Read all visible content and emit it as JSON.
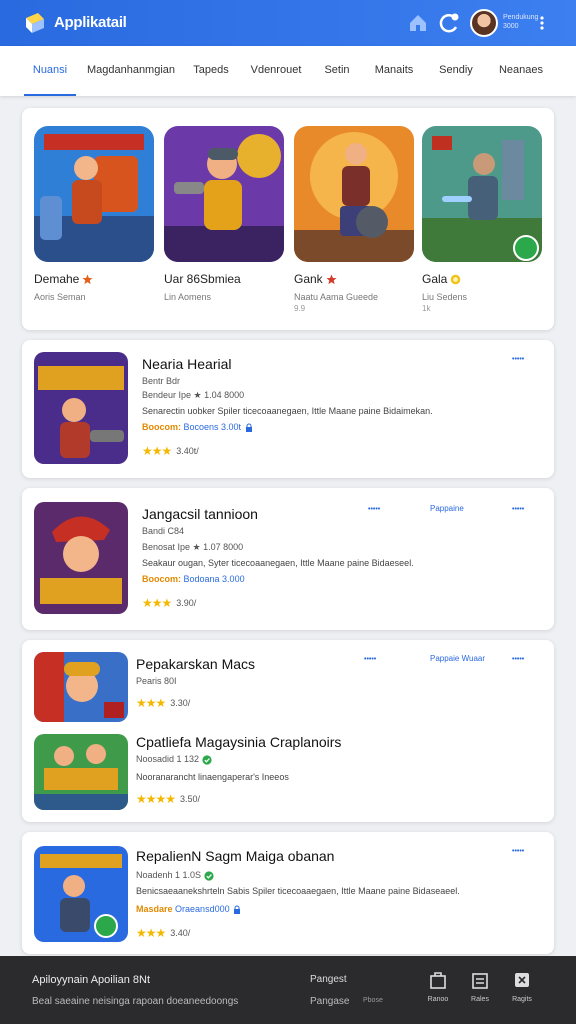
{
  "app": {
    "title": "Applikatail"
  },
  "header": {
    "user_line1": "Pendukung",
    "user_line2": "3000"
  },
  "tabs": [
    "Nuansi",
    "Magdanhanmgian",
    "Tapeds",
    "Vdenrouet",
    "Setin",
    "Manaits",
    "Sendiy",
    "Neanaes"
  ],
  "colors": {
    "primary": "#2a6ae0",
    "accent_orange": "#e08a00",
    "star": "#f5b800",
    "footer_bg": "#2b2b2d"
  },
  "featured": [
    {
      "name": "Demahe",
      "sub": "Aoris Seman",
      "sub2": "",
      "badge": "star-icon"
    },
    {
      "name": "Uar 86Sbmiea",
      "sub": "Lin Aomens",
      "sub2": "",
      "badge": ""
    },
    {
      "name": "Gank",
      "sub": "Naatu Aama Gueede",
      "sub2": "9.9",
      "badge": "star-icon"
    },
    {
      "name": "Gala",
      "sub": "Liu Sedens",
      "sub2": "1k",
      "badge": "coin-icon"
    }
  ],
  "list1": {
    "title": "Nearia Hearial",
    "meta1": "Bentr Bdr",
    "meta2": "Bendeur Ipe ★ 1.04 8000",
    "desc": "Senarectin uobker Spiler ticecoaanegaen, Ittle Maane paine Bidaimekan.",
    "price_orange": "Boocom:",
    "price_blue": "Bocoens 3.00t",
    "rating": "3.40t/",
    "stars": "★★★",
    "tag": "•••••"
  },
  "list2": {
    "title": "Jangacsil tannioon",
    "meta1": "Bandi C84",
    "meta2": "Benosat Ipe ★ 1.07 8000",
    "desc": "Seakaur ougan, Syter ticecoaanegaen, Ittle Maane paine Bidaeseel.",
    "price_orange": "Boocom:",
    "price_blue": "Bodoana 3.000",
    "rating": "3.90/",
    "stars": "★★★",
    "tag1": "•••••",
    "tag2": "Pappaine",
    "tag3": "•••••"
  },
  "list3": {
    "item1": {
      "title": "Pepakarskan Macs",
      "meta": "Pearis 80I",
      "rating": "3.30/",
      "stars": "★★★"
    },
    "item2": {
      "title": "Cpatliefa Magaysinia Craplanoirs",
      "meta": "Noosadid 1 132",
      "desc": "Nooranarancht linaengaperar's Ineeos",
      "rating": "3.50/",
      "stars": "★★★★"
    },
    "tag1": "•••••",
    "tag2": "Pappaie Wuaar",
    "tag3": "•••••"
  },
  "list4": {
    "title": "RepalienN Sagm Maiga obanan",
    "meta": "Noadenh 1 1.0S",
    "desc": "Benicsaeaanekshrteln Sabis Spiler ticecoaaegaen, Ittle Maane paine Bidaseaeel.",
    "price_orange": "Masdare",
    "price_blue": "Oraeansd000",
    "rating": "3.40/",
    "stars": "★★★",
    "tag": "•••••"
  },
  "footer": {
    "line1": "Apiloyynain Apoilian 8Nt",
    "line2": "Beal saeaine neisinga rapoan doeaneedoongs",
    "col_title": "Pangest",
    "col_sub": "Pangase",
    "col_note": "Pbose",
    "btn1": "Ranoo",
    "btn2": "Rales",
    "btn3": "Ragits"
  }
}
